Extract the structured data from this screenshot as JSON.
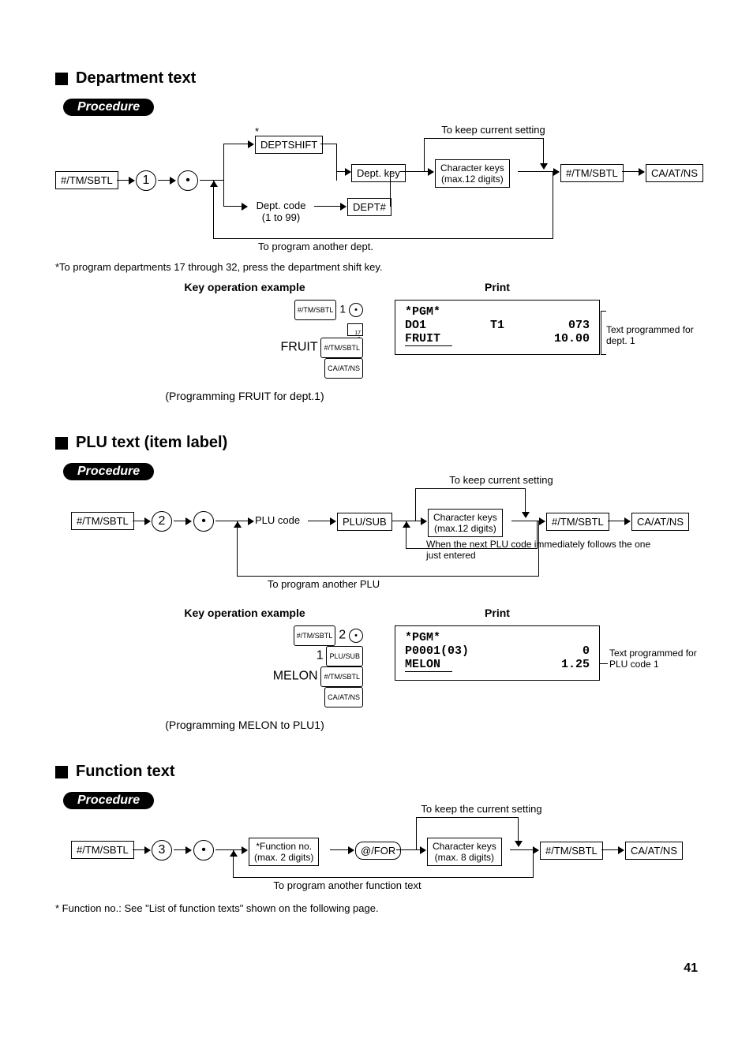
{
  "page_number": "41",
  "sections": {
    "dept": {
      "title": "Department text",
      "procedure": "Procedure",
      "flow": {
        "k1": "#/TM/SBTL",
        "n1": "1",
        "dot": "•",
        "deptshift": "DEPTSHIFT",
        "deptshift_star": "*",
        "deptkey": "Dept. key",
        "deptcode": "Dept. code\n(1 to 99)",
        "depthash": "DEPT#",
        "charkeys": "Character keys\n(max.12 digits)",
        "keepcurrent": "To keep current setting",
        "k2": "#/TM/SBTL",
        "k3": "CA/AT/NS",
        "loopnote": "To program another dept."
      },
      "footnote": "*To program departments 17 through 32, press the department shift key.",
      "example": {
        "keyop_head": "Key operation example",
        "print_head": "Print",
        "line1_num": "1",
        "line17": "17\n1",
        "fruit": "FRUIT",
        "keys": {
          "sbtl": "#/TM/SBTL",
          "caat": "CA/AT/NS"
        },
        "caption": "(Programming FRUIT for dept.1)",
        "receipt": {
          "l1": "*PGM*",
          "l2a": "DO1",
          "l2b": "T1",
          "l2c": "073",
          "l3a": "FRUIT",
          "l3b": "10.00"
        },
        "sidecap": "Text programmed for dept. 1"
      }
    },
    "plu": {
      "title": "PLU text (item label)",
      "procedure": "Procedure",
      "flow": {
        "k1": "#/TM/SBTL",
        "n1": "2",
        "dot": "•",
        "plucode": "PLU code",
        "plusub": "PLU/SUB",
        "charkeys": "Character keys\n(max.12 digits)",
        "keepcurrent": "To keep current setting",
        "k2": "#/TM/SBTL",
        "k3": "CA/AT/NS",
        "loopnote": "To program another PLU",
        "follownote": "When the next PLU code immediately follows the one just entered"
      },
      "example": {
        "keyop_head": "Key operation example",
        "print_head": "Print",
        "num2": "2",
        "num1": "1",
        "plusub": "PLU/SUB",
        "melon": "MELON",
        "keys": {
          "sbtl": "#/TM/SBTL",
          "caat": "CA/AT/NS"
        },
        "caption": "(Programming MELON to PLU1)",
        "receipt": {
          "l1": "*PGM*",
          "l2a": "P0001(03)",
          "l2b": "0",
          "l3a": "MELON",
          "l3b": "1.25"
        },
        "sidecap": "Text programmed for PLU code 1"
      }
    },
    "func": {
      "title": "Function text",
      "procedure": "Procedure",
      "flow": {
        "k1": "#/TM/SBTL",
        "n1": "3",
        "dot": "•",
        "funcno": "*Function no.\n(max. 2 digits)",
        "atfor": "@/FOR",
        "charkeys": "Character keys\n(max. 8 digits)",
        "keepcurrent": "To keep the current setting",
        "k2": "#/TM/SBTL",
        "k3": "CA/AT/NS",
        "loopnote": "To program another function text"
      },
      "footnote": "* Function no.: See \"List of function texts\" shown on the following page."
    }
  }
}
